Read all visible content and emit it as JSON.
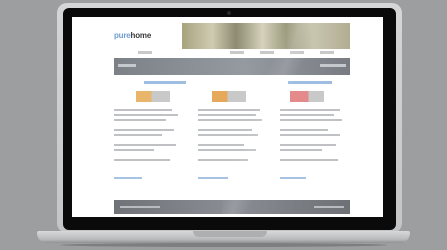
{
  "site": {
    "logo_part1": "pure",
    "logo_part2": "home"
  },
  "colors": {
    "accent": "#6e9fd4",
    "banner": "#8a8e94",
    "thumb_left": "#e8b56a",
    "thumb_mid": "#e6a85a",
    "thumb_right": "#e58a8a"
  }
}
